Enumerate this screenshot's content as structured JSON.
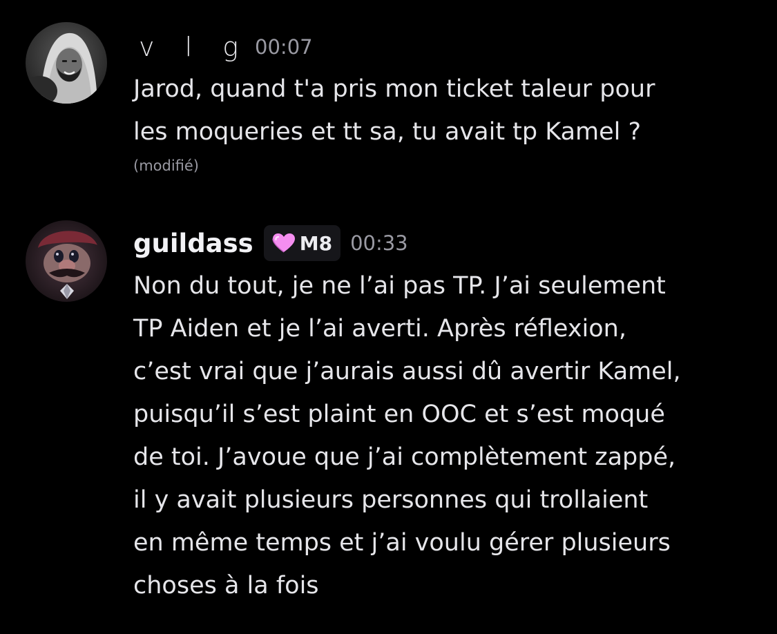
{
  "messages": [
    {
      "username": "v l g",
      "timestamp": "00:07",
      "avatar_icon": "user-avatar-photo",
      "content": "Jarod, quand t'a pris mon ticket taleur pour\nles moqueries et tt sa, tu avait tp Kamel ?",
      "edited_label": "(modifié)"
    },
    {
      "username": "guildass",
      "badge": {
        "icon": "pink-heart-icon",
        "label": "M8"
      },
      "timestamp": "00:33",
      "avatar_icon": "mario-avatar",
      "content": "Non du tout, je ne l’ai pas TP. J’ai seulement\nTP Aiden et je l’ai averti. Après réflexion,\nc’est vrai que j’aurais aussi dû avertir Kamel,\npuisqu’il s’est plaint en OOC et s’est moqué\nde toi. J’avoue que j’ai complètement zappé,\nil y avait plusieurs personnes qui trollaient\nen même temps et j’ai voulu gérer plusieurs\nchoses à la fois"
    }
  ],
  "colors": {
    "background": "#000000",
    "text": "#e6e6ea",
    "muted": "#9a9aa3",
    "badge_bg": "#16161a",
    "heart": "#f58ef0"
  }
}
